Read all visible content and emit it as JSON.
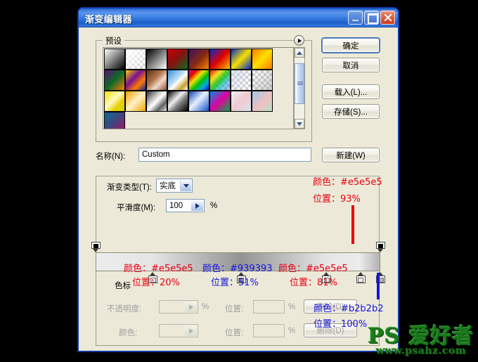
{
  "window": {
    "title": "渐变编辑器",
    "minimize_label": "最小化",
    "maximize_label": "最大化",
    "close_label": "关闭"
  },
  "presets": {
    "group_label": "预设",
    "menu_label": "预设菜单",
    "swatches": [
      {
        "name": "foreground-to-background",
        "css": "linear-gradient(135deg,#ffffff 0%,#000000 100%)",
        "checker": false
      },
      {
        "name": "foreground-to-transparent",
        "css": "linear-gradient(135deg,#ffffff 0%,rgba(255,255,255,0) 100%)",
        "checker": true
      },
      {
        "name": "black-white",
        "css": "linear-gradient(135deg,#000000 0%,#ffffff 100%)",
        "checker": false
      },
      {
        "name": "red-green",
        "css": "linear-gradient(135deg,#cc0000 0%,#8a1010 45%,#0a6b1e 100%)",
        "checker": false
      },
      {
        "name": "violet-orange",
        "css": "linear-gradient(135deg,#3d1060 0%,#8a2a10 55%,#ff8800 100%)",
        "checker": false
      },
      {
        "name": "blue-red-yellow",
        "css": "linear-gradient(135deg,#0a28c8 0%,#e00000 50%,#f5c400 100%)",
        "checker": false
      },
      {
        "name": "blue-yellow-blue",
        "css": "linear-gradient(135deg,#0a28c8 0%,#f5e000 50%,#0a28c8 100%)",
        "checker": false
      },
      {
        "name": "orange-yellow-orange",
        "css": "linear-gradient(135deg,#ff7a00 0%,#ffe000 50%,#ff7a00 100%)",
        "checker": false
      },
      {
        "name": "violet-green-orange",
        "css": "linear-gradient(135deg,#5d1070 0%,#0a6b28 50%,#ff7a00 100%)",
        "checker": false
      },
      {
        "name": "yellow-violet-orange-blue",
        "css": "linear-gradient(135deg,#ffd000 0%,#7a1090 40%,#ff7a00 70%,#0a28a8 100%)",
        "checker": false
      },
      {
        "name": "copper",
        "css": "linear-gradient(135deg,#5a3216 0%,#b0714a 40%,#f0d8c8 65%,#8a5030 100%)",
        "checker": false
      },
      {
        "name": "chrome",
        "css": "linear-gradient(135deg,#3a90d8 0%,#bfe0f5 45%,#ffffff 55%,#c8a030 80%,#ffffff 100%)",
        "checker": false
      },
      {
        "name": "spectrum",
        "css": "linear-gradient(135deg,#ff00a0 0%,#e00000 18%,#f5e000 38%,#00c000 58%,#00b0e0 78%,#3000c0 100%)",
        "checker": false
      },
      {
        "name": "transparent-rainbow",
        "css": "linear-gradient(135deg,rgba(255,0,0,.95) 0%,rgba(245,224,0,.85) 28%,rgba(0,192,0,.8) 50%,rgba(0,176,224,.6) 72%,rgba(48,0,192,.25) 100%)",
        "checker": true
      },
      {
        "name": "transparent-stripes",
        "css": "linear-gradient(135deg,rgba(200,210,230,.55) 0%,rgba(255,255,255,0) 100%)",
        "checker": true
      },
      {
        "name": "transparent-to-gray",
        "css": "linear-gradient(135deg,rgba(255,255,255,0) 0%,rgba(170,170,170,.55) 100%)",
        "checker": true
      },
      {
        "name": "yellow-green",
        "css": "linear-gradient(135deg,#f5e000 0%,#fff8c0 45%,#e8d000 70%,#c8d800 100%)",
        "checker": false
      },
      {
        "name": "orange-cream",
        "css": "linear-gradient(135deg,#f0a000 0%,#fff0c8 50%,#f0a800 100%)",
        "checker": false
      },
      {
        "name": "steel-bar",
        "css": "linear-gradient(135deg,#303030 0%,#c8c8c8 35%,#ffffff 50%,#606060 75%,#e0e0e0 100%)",
        "checker": false
      },
      {
        "name": "silver-black",
        "css": "linear-gradient(135deg,#000000 0%,#f0f0f0 40%,#808080 60%,#000000 100%)",
        "checker": false
      },
      {
        "name": "blue-white-blue",
        "css": "linear-gradient(135deg,#0a40b0 0%,#e8f0ff 45%,#1050c8 100%)",
        "checker": false
      },
      {
        "name": "blue-magenta-green",
        "css": "linear-gradient(135deg,#0090e0 0%,#e000a0 50%,#00b040 100%)",
        "checker": false
      },
      {
        "name": "pastel-pink",
        "css": "linear-gradient(135deg,#eef4fa 0%,#f0c8d0 50%,#d8e4ea 100%)",
        "checker": false
      },
      {
        "name": "pastel-blue-green",
        "css": "linear-gradient(135deg,#9ec8e8 0%,#f0c0c0 55%,#b8e0c8 100%)",
        "checker": false
      },
      {
        "name": "teal-magenta",
        "css": "linear-gradient(135deg,#106890 0%,#3a4880 45%,#b01060 100%)",
        "checker": false
      }
    ]
  },
  "name_row": {
    "label": "名称(N):",
    "value": "Custom",
    "new_button": "新建(W)"
  },
  "buttons": {
    "ok": "确定",
    "cancel": "取消",
    "load": "载入(L)...",
    "save": "存储(S)..."
  },
  "gradient_type": {
    "label": "渐变类型(T):",
    "value": "实底"
  },
  "smoothness": {
    "label": "平滑度(M):",
    "value": "100",
    "unit": "%"
  },
  "gradient_strip": {
    "css": "linear-gradient(90deg,#ededed 0%,#e5e5e5 20%,#939393 51%,#e5e5e5 81%,#ececec 93%,#b2b2b2 100%)",
    "opacity_stops": [
      {
        "name": "opacity-stop-start",
        "position": 0,
        "opacity": 100
      },
      {
        "name": "opacity-stop-end",
        "position": 100,
        "opacity": 100
      }
    ],
    "color_stops": [
      {
        "name": "color-stop-1",
        "position": 20,
        "color": "#e5e5e5"
      },
      {
        "name": "color-stop-2",
        "position": 51,
        "color": "#939393"
      },
      {
        "name": "color-stop-3",
        "position": 81,
        "color": "#e5e5e5"
      },
      {
        "name": "color-stop-4",
        "position": 93,
        "color": "#ececec"
      },
      {
        "name": "color-stop-5",
        "position": 100,
        "color": "#b2b2b2"
      }
    ]
  },
  "stops_group": {
    "label": "色标",
    "opacity_label": "不透明度:",
    "opacity_value": "",
    "opacity_unit": "%",
    "position_label_1": "位置:",
    "position_value_1": "",
    "position_unit_1": "%",
    "delete_button_1": "删除(D)",
    "color_label": "颜色:",
    "position_label_2": "位置:",
    "position_value_2": "",
    "position_unit_2": "%",
    "delete_button_2": "删除(D)"
  },
  "annotations": [
    {
      "name": "annotation-stop-93",
      "color_text": "颜色：#e5e5e5",
      "position_text": "位置：93%",
      "accent": "#e8000f"
    },
    {
      "name": "annotation-stop-20",
      "color_text": "颜色：#e5e5e5",
      "position_text": "位置：20%",
      "accent": "#e8000f"
    },
    {
      "name": "annotation-stop-51",
      "color_text": "颜色：#939393",
      "position_text": "位置：51%",
      "accent": "#1414e0"
    },
    {
      "name": "annotation-stop-81",
      "color_text": "颜色：#e5e5e5",
      "position_text": "位置：81%",
      "accent": "#e8000f"
    },
    {
      "name": "annotation-stop-100",
      "color_text": "颜色：#b2b2b2",
      "position_text": "位置：100%",
      "accent": "#1414e0"
    }
  ],
  "watermark": {
    "brand": "PS 爱好者",
    "url": "www.psahz.com"
  }
}
